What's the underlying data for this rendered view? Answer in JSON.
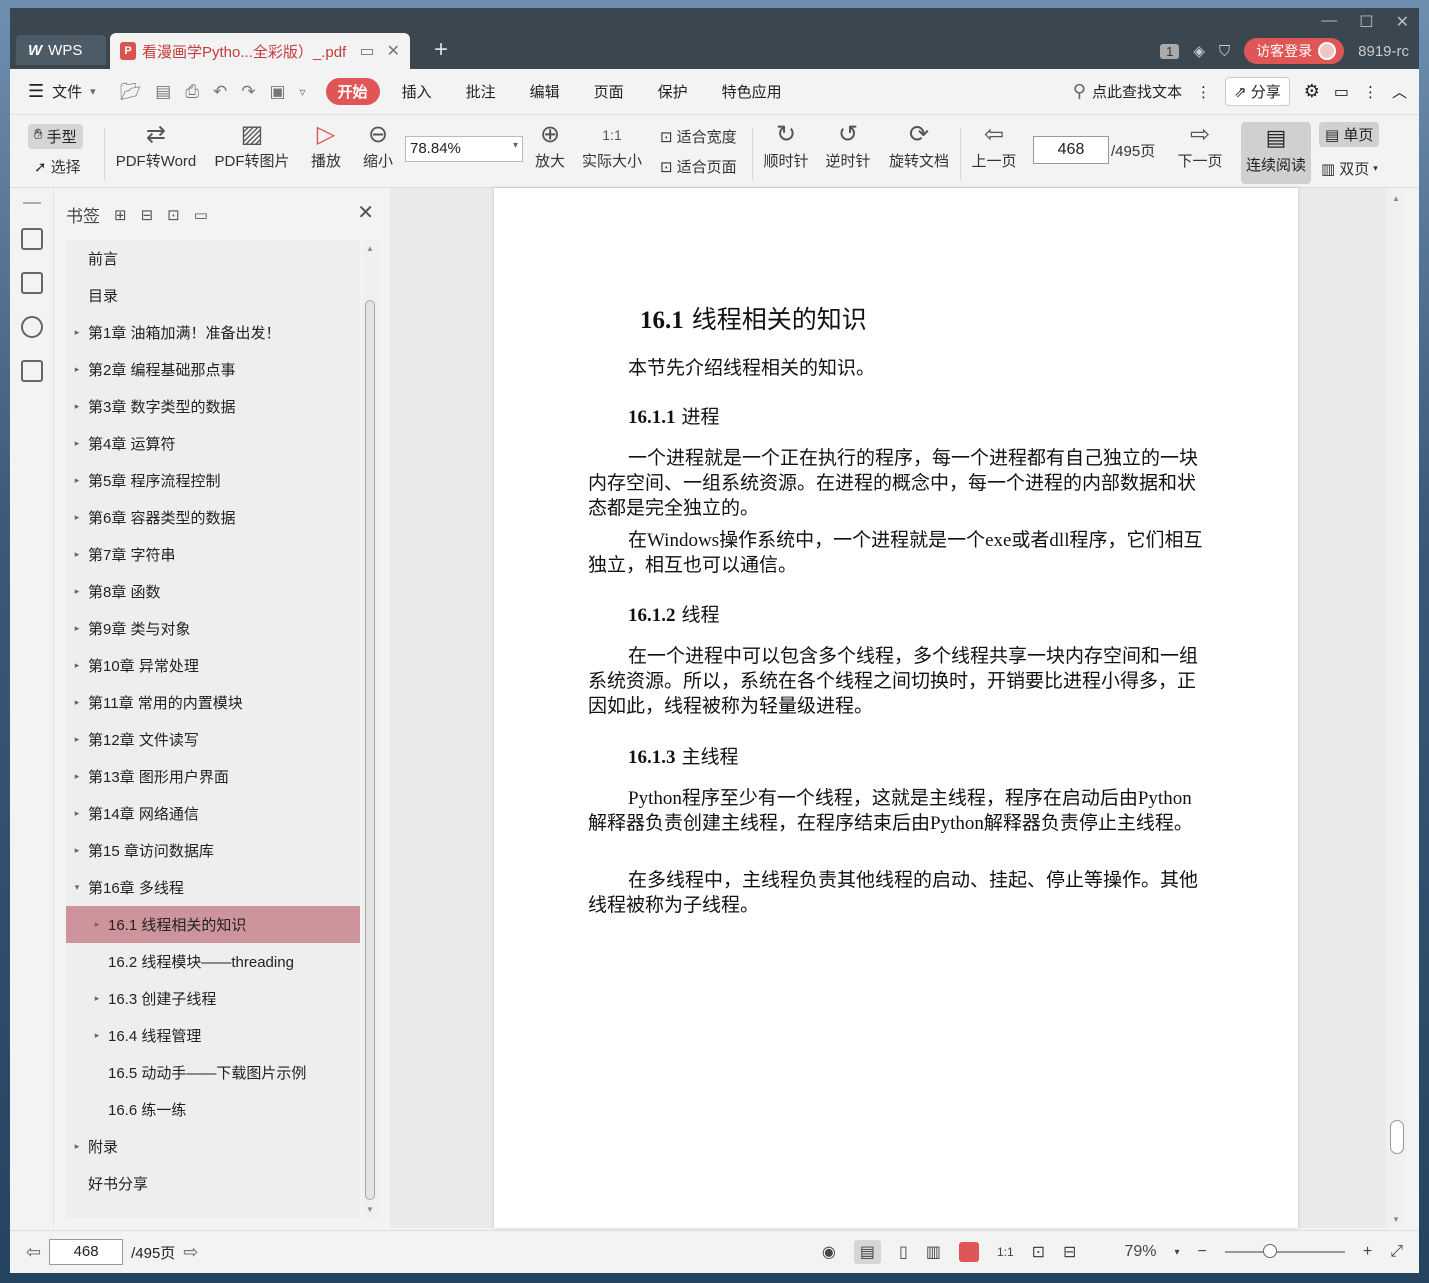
{
  "titlebar": {
    "wps_label": "WPS",
    "doc_tab_title": "看漫画学Pytho...全彩版）_.pdf",
    "new_tab_symbol": "+",
    "page_badge": "1",
    "login_label": "访客登录",
    "user_id": "8919-rc"
  },
  "menubar": {
    "file_label": "文件",
    "tabs": [
      "开始",
      "插入",
      "批注",
      "编辑",
      "页面",
      "保护",
      "特色应用"
    ],
    "search_label": "点此查找文本",
    "share_label": "分享"
  },
  "toolbar": {
    "hand": "手型",
    "select": "选择",
    "pdf_to_word": "PDF转Word",
    "pdf_to_image": "PDF转图片",
    "play": "播放",
    "zoom_out": "缩小",
    "zoom_value": "78.84%",
    "zoom_in": "放大",
    "actual_size": "实际大小",
    "fit_width": "适合宽度",
    "fit_page": "适合页面",
    "rotate_cw": "顺时针",
    "rotate_ccw": "逆时针",
    "rotate_doc": "旋转文档",
    "prev_page": "上一页",
    "current_page": "468",
    "total_pages": "/495页",
    "next_page": "下一页",
    "continuous": "连续阅读",
    "single": "单页",
    "double": "双页"
  },
  "bookmarks": {
    "title": "书签",
    "items": [
      {
        "label": "前言",
        "arrow": ""
      },
      {
        "label": "目录",
        "arrow": ""
      },
      {
        "label": "第1章 油箱加满！准备出发！",
        "arrow": "▸"
      },
      {
        "label": "第2章 编程基础那点事",
        "arrow": "▸"
      },
      {
        "label": "第3章 数字类型的数据",
        "arrow": "▸"
      },
      {
        "label": "第4章 运算符",
        "arrow": "▸"
      },
      {
        "label": "第5章 程序流程控制",
        "arrow": "▸"
      },
      {
        "label": "第6章 容器类型的数据",
        "arrow": "▸"
      },
      {
        "label": "第7章 字符串",
        "arrow": "▸"
      },
      {
        "label": "第8章 函数",
        "arrow": "▸"
      },
      {
        "label": "第9章 类与对象",
        "arrow": "▸"
      },
      {
        "label": "第10章 异常处理",
        "arrow": "▸"
      },
      {
        "label": "第11章 常用的内置模块",
        "arrow": "▸"
      },
      {
        "label": "第12章 文件读写",
        "arrow": "▸"
      },
      {
        "label": "第13章 图形用户界面",
        "arrow": "▸"
      },
      {
        "label": "第14章 网络通信",
        "arrow": "▸"
      },
      {
        "label": "第15 章访问数据库",
        "arrow": "▸"
      },
      {
        "label": "第16章 多线程",
        "arrow": "▾"
      },
      {
        "label": "16.1 线程相关的知识",
        "arrow": "▸"
      },
      {
        "label": "16.2 线程模块——threading",
        "arrow": ""
      },
      {
        "label": "16.3 创建子线程",
        "arrow": "▸"
      },
      {
        "label": "16.4 线程管理",
        "arrow": "▸"
      },
      {
        "label": "16.5 动动手——下载图片示例",
        "arrow": ""
      },
      {
        "label": "16.6 练一练",
        "arrow": ""
      },
      {
        "label": "附录",
        "arrow": "▸"
      },
      {
        "label": "好书分享",
        "arrow": ""
      }
    ]
  },
  "document": {
    "section_num": "16.1",
    "section_title": "线程相关的知识",
    "intro": "本节先介绍线程相关的知识。",
    "sub1_num": "16.1.1",
    "sub1_title": "进程",
    "p1": "一个进程就是一个正在执行的程序，每一个进程都有自己独立的一块内存空间、一组系统资源。在进程的概念中，每一个进程的内部数据和状态都是完全独立的。",
    "p2": "在Windows操作系统中，一个进程就是一个exe或者dll程序，它们相互独立，相互也可以通信。",
    "sub2_num": "16.1.2",
    "sub2_title": "线程",
    "p3": "在一个进程中可以包含多个线程，多个线程共享一块内存空间和一组系统资源。所以，系统在各个线程之间切换时，开销要比进程小得多，正因如此，线程被称为轻量级进程。",
    "sub3_num": "16.1.3",
    "sub3_title": "主线程",
    "p4": "Python程序至少有一个线程，这就是主线程，程序在启动后由Python解释器负责创建主线程，在程序结束后由Python解释器负责停止主线程。",
    "p5": "在多线程中，主线程负责其他线程的启动、挂起、停止等操作。其他线程被称为子线程。"
  },
  "statusbar": {
    "page": "468",
    "total": "/495页",
    "zoom": "79%"
  }
}
